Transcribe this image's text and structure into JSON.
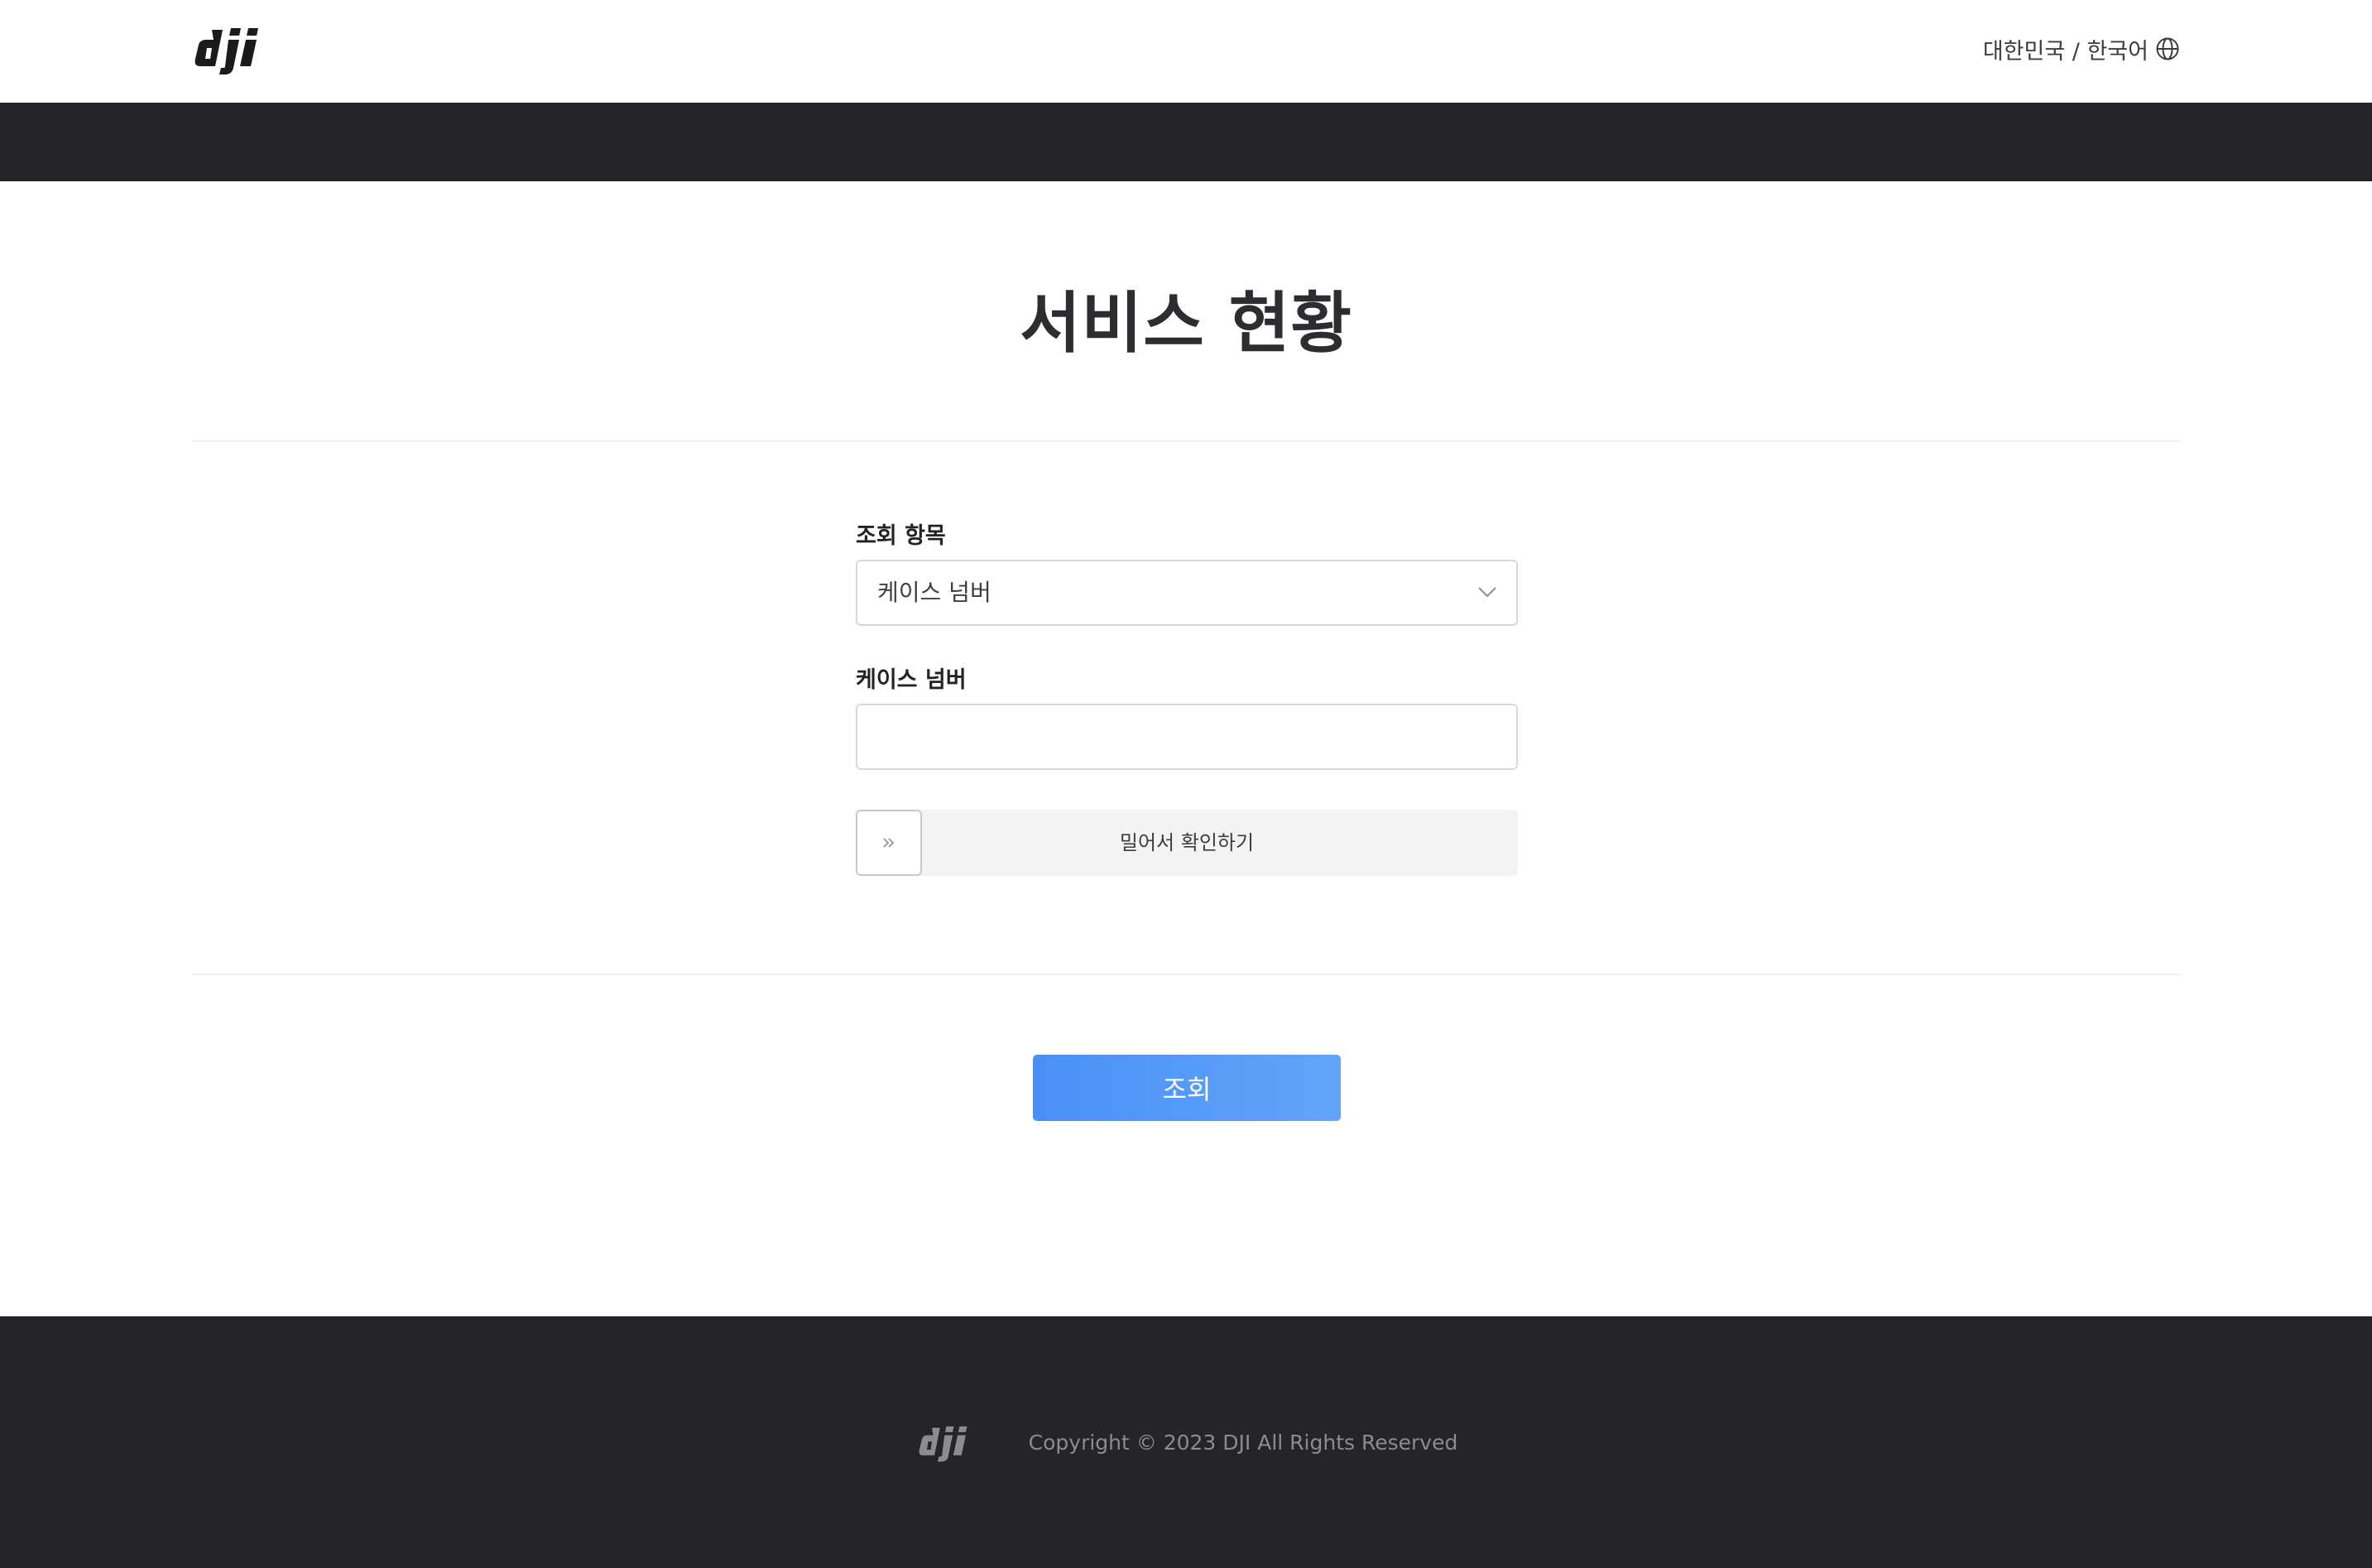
{
  "header": {
    "logo_icon": "dji-logo-icon",
    "language_label": "대한민국 / 한국어",
    "language_icon": "globe-icon"
  },
  "main": {
    "title": "서비스 현황",
    "query_type": {
      "label": "조회 항목",
      "selected_value": "케이스 넘버",
      "icon": "chevron-down-icon"
    },
    "case_number": {
      "label": "케이스 넘버",
      "value": "",
      "placeholder": ""
    },
    "slider": {
      "text": "밀어서 확인하기",
      "handle_icon": "double-chevron-right-icon",
      "progress": 0
    },
    "submit_label": "조회"
  },
  "footer": {
    "logo_icon": "dji-logo-icon",
    "copyright": "Copyright © 2023 DJI All Rights Reserved"
  },
  "colors": {
    "dark_bar": "#242528",
    "primary_button": "#4a90f5",
    "divider": "#f0f0f0"
  }
}
